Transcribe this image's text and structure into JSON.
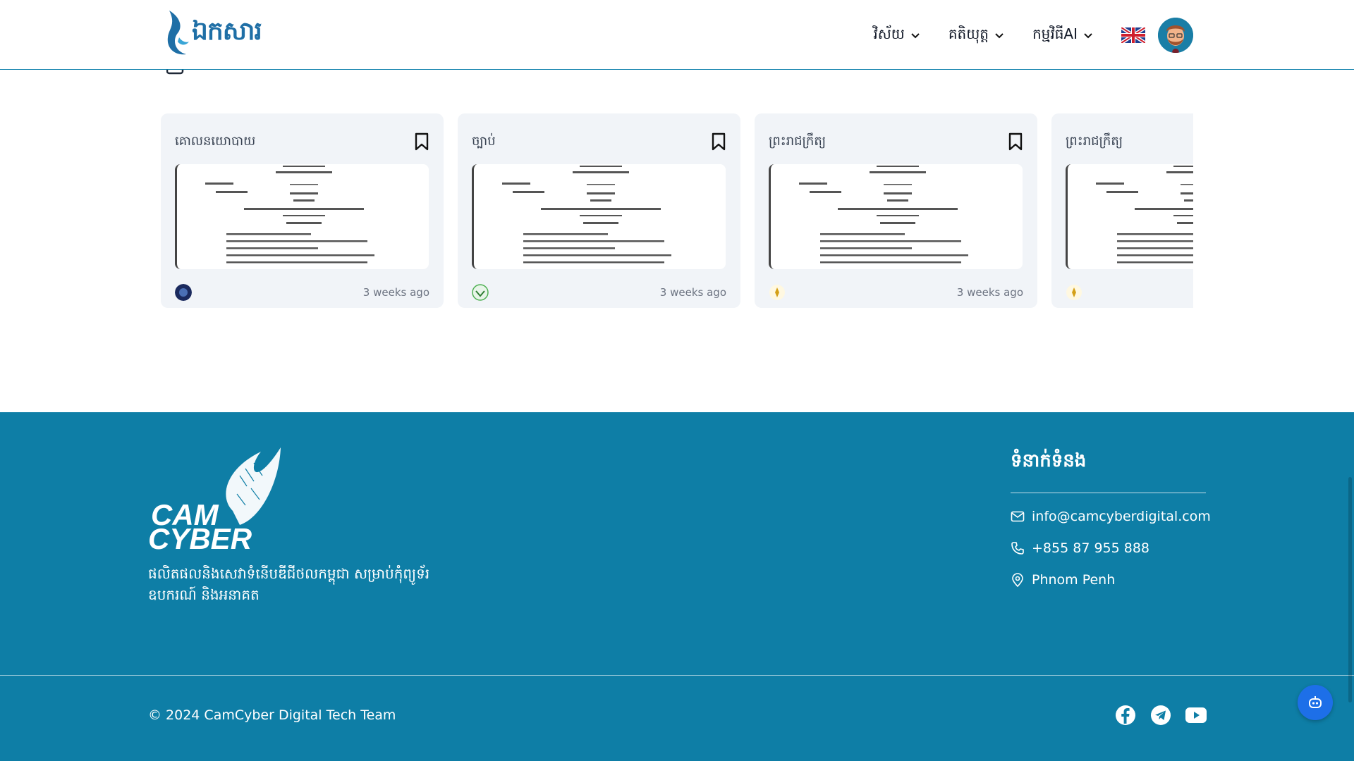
{
  "header": {
    "logo_text": "ឯកសារ",
    "nav": [
      {
        "label": "វិស័យ"
      },
      {
        "label": "គតិយុត្ត"
      },
      {
        "label": "កម្មវិធីAI"
      }
    ],
    "language_icon": "uk-flag-icon",
    "avatar_icon": "user-avatar-icon"
  },
  "cards": [
    {
      "category": "គោលនយោបាយ",
      "time": "3 weeks ago",
      "source_icon": "ministry-seal-icon"
    },
    {
      "category": "ច្បាប់",
      "time": "3 weeks ago",
      "source_icon": "green-emblem-icon"
    },
    {
      "category": "ព្រះរាជក្រឹត្យ",
      "time": "3 weeks ago",
      "source_icon": "royal-emblem-icon"
    },
    {
      "category": "ព្រះរាជក្រឹត្យ",
      "time": "",
      "source_icon": "royal-emblem-icon"
    }
  ],
  "footer": {
    "logo_text_1": "CAM",
    "logo_text_2": "CYBER",
    "tagline": "ផលិតផលនិងសេវាទំនើបឌីជីថលកម្ពុជា សម្រាប់កុំព្យូទ័រ ឧបករណ៍ និងអនាគត",
    "contact_title": "ទំនាក់ទំនង",
    "email": "info@camcyberdigital.com",
    "phone": "+855 87 955 888",
    "location": "Phnom Penh",
    "copyright": "© 2024 CamCyber Digital Tech Team",
    "socials": [
      "facebook-icon",
      "telegram-icon",
      "youtube-icon"
    ]
  },
  "colors": {
    "brand": "#0e7ea6",
    "card_bg": "#f1f4f8",
    "chatbot": "#1d6fe8"
  }
}
